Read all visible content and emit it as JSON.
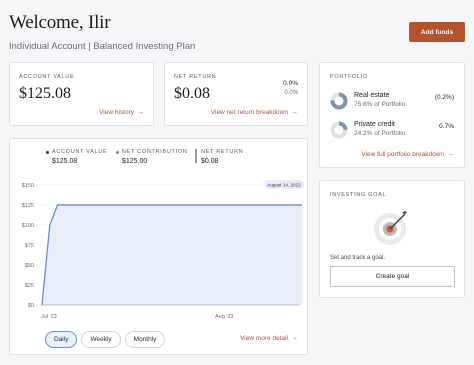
{
  "header": {
    "welcome": "Welcome, Ilir",
    "subtitle": "Individual Account | Balanced Investing Plan",
    "add_funds": "Add funds"
  },
  "account_value": {
    "label": "ACCOUNT VALUE",
    "value": "$125.08",
    "link": "View history"
  },
  "net_return": {
    "label": "NET RETURN",
    "value": "$0.08",
    "percent": "0.0%",
    "percent_sub": "0.0%",
    "link": "View net return breakdown"
  },
  "chart": {
    "legend": [
      {
        "label": "ACCOUNT VALUE",
        "value": "$125.08",
        "color": "#3a3d42"
      },
      {
        "label": "NET CONTRIBUTION",
        "value": "$125.00",
        "color": "#6c8fbf"
      },
      {
        "label": "NET RETURN",
        "value": "$0.08",
        "color": "#9aa0a6"
      }
    ],
    "tooltip_date": "August 14, 2023",
    "view_more": "View more detail",
    "tabs": [
      "Daily",
      "Weekly",
      "Monthly"
    ],
    "active_tab": "Daily"
  },
  "chart_data": {
    "type": "area",
    "x": [
      "Jul '23",
      "",
      "Aug '23",
      "Aug 14"
    ],
    "xlabel": "",
    "ylabel": "",
    "yticks": [
      "$150",
      "$125",
      "$100",
      "$75",
      "$50",
      "$25",
      "$0"
    ],
    "ylim": [
      0,
      150
    ],
    "x_tick_labels": [
      "Jul '23",
      "Aug '23"
    ],
    "series": [
      {
        "values": [
          0,
          100,
          125.08,
          125.08,
          125.08
        ]
      }
    ],
    "grid": true
  },
  "portfolio": {
    "label": "PORTFOLIO",
    "items": [
      {
        "name": "Real estate",
        "sub": "75.8% of Portfolio",
        "pct": "(0.2%)",
        "fraction": 0.758
      },
      {
        "name": "Private credit",
        "sub": "24.2% of Portfolio",
        "pct": "0.7%",
        "fraction": 0.242
      }
    ],
    "link": "View full portfolio breakdown"
  },
  "goal": {
    "label": "INVESTING GOAL",
    "text": "Set and track a goal.",
    "button": "Create goal"
  }
}
